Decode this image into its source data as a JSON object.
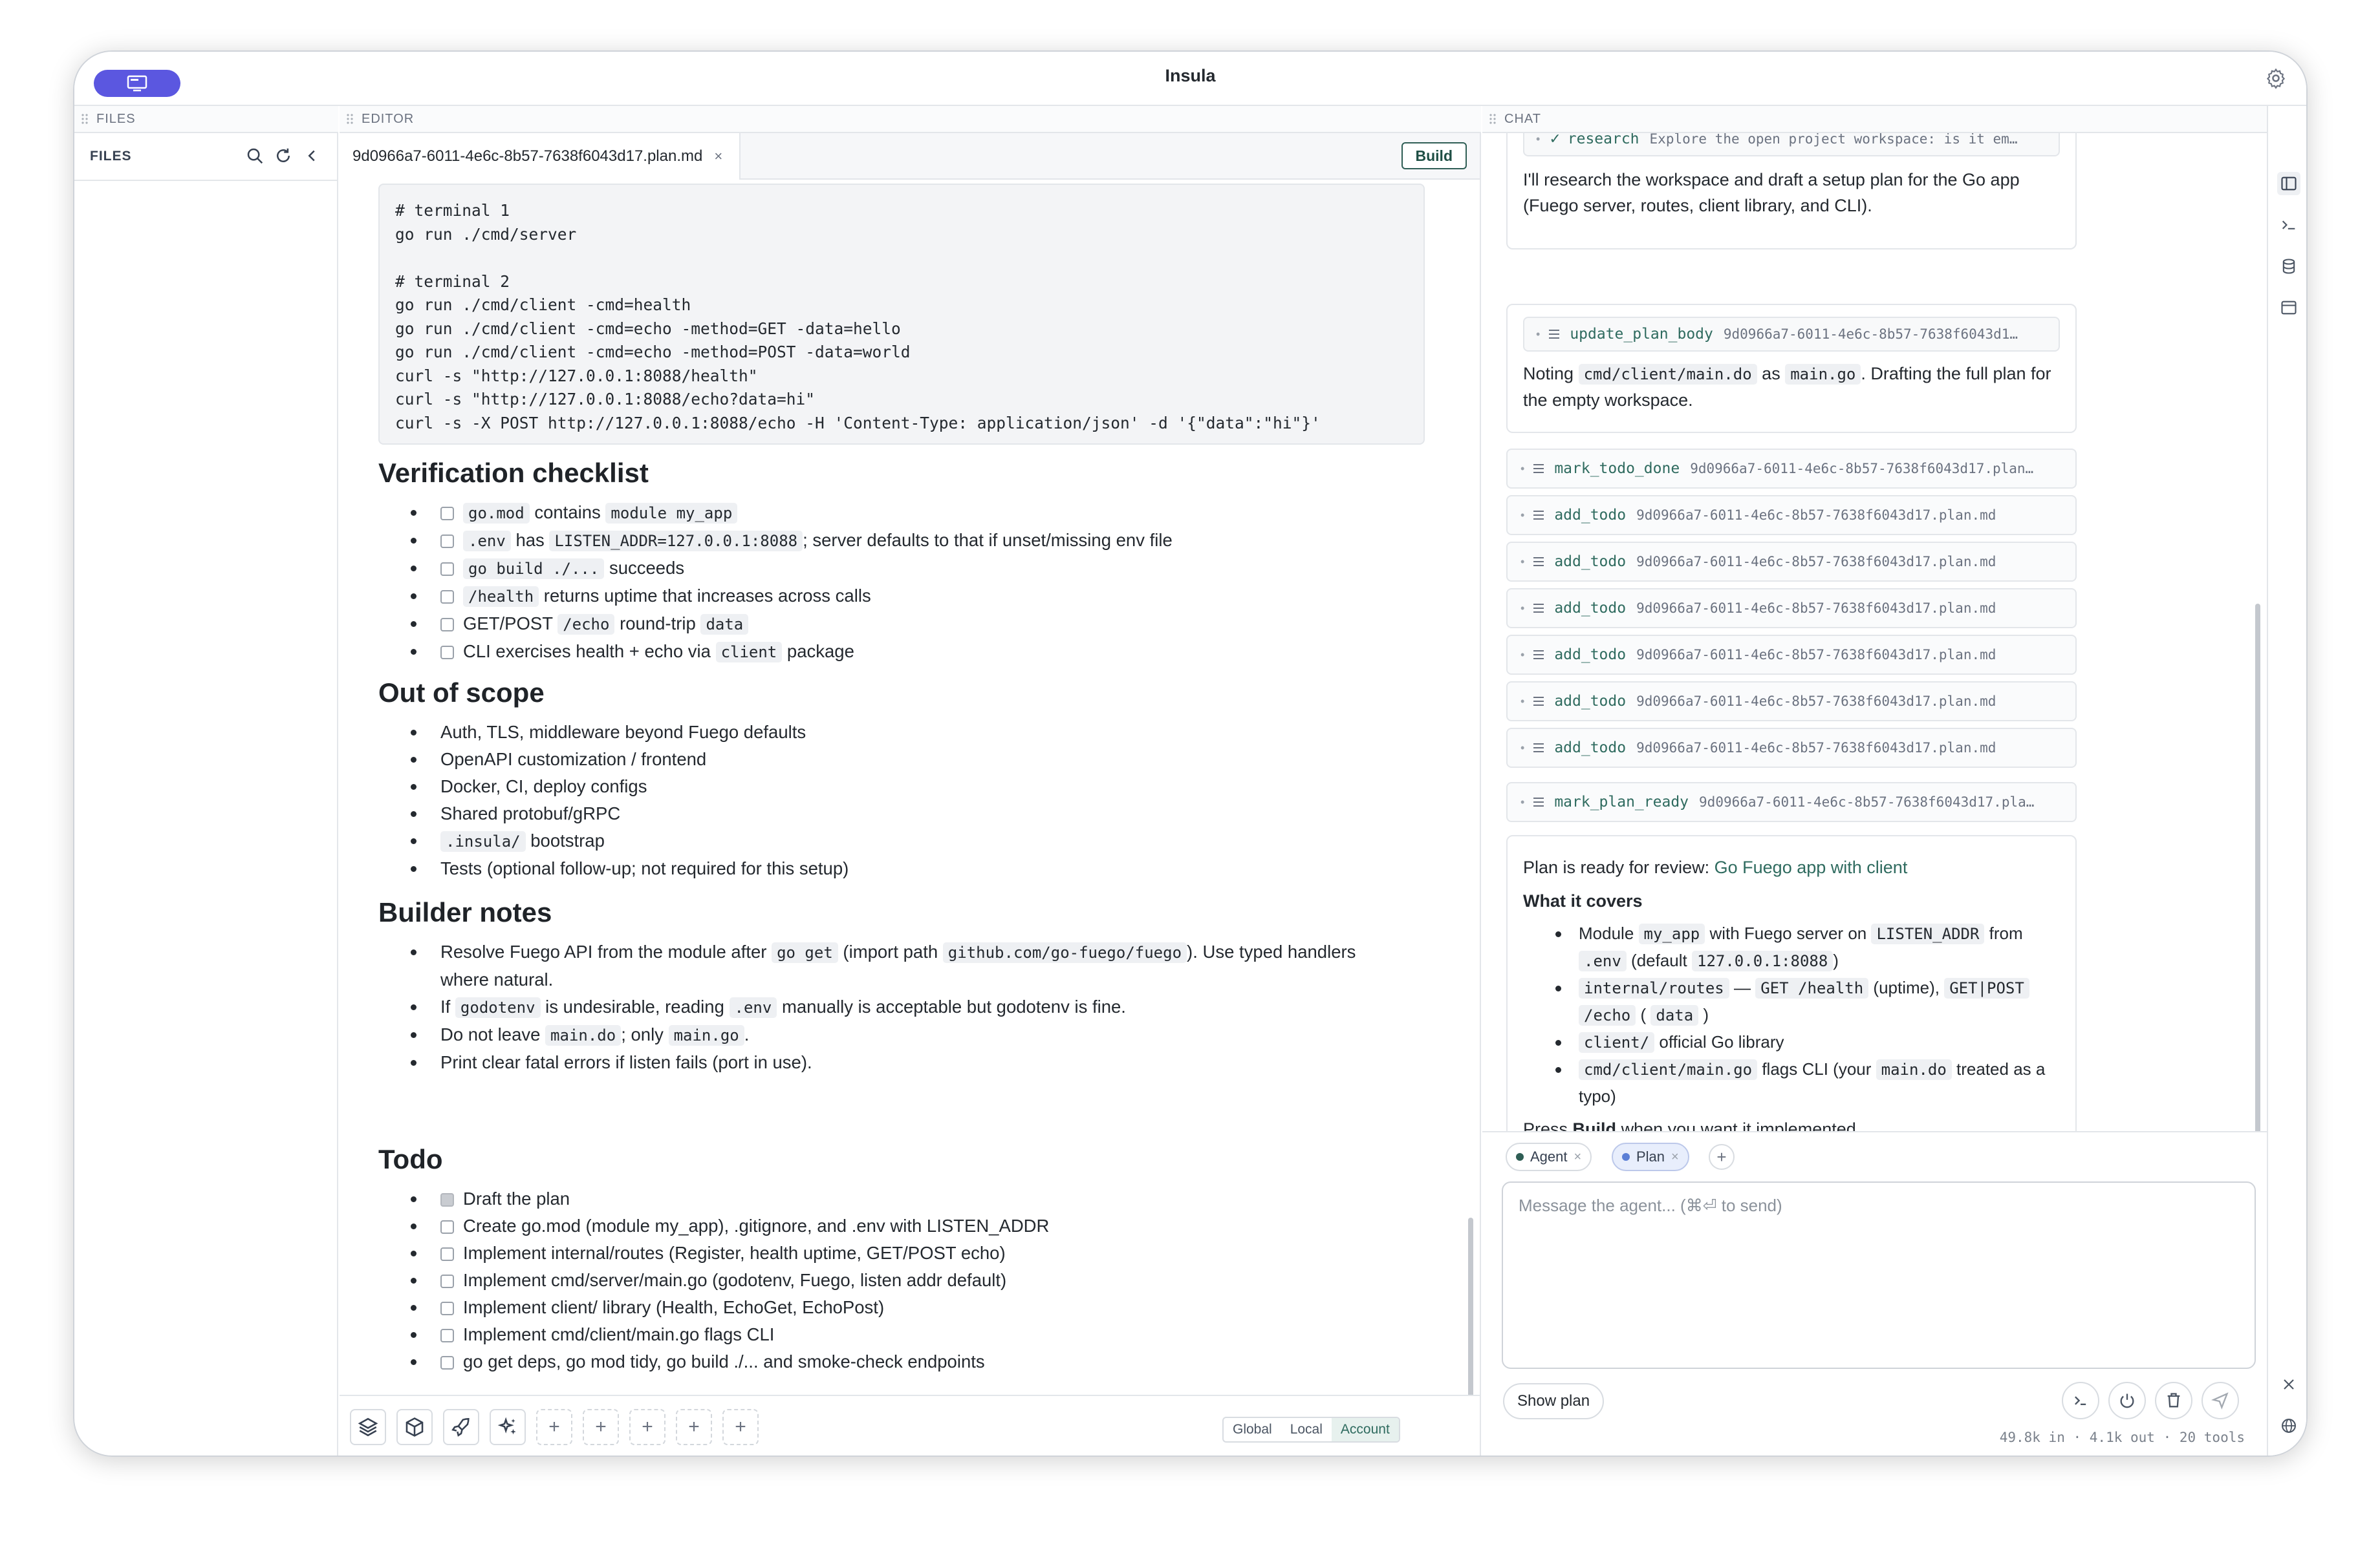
{
  "app": {
    "title": "Insula"
  },
  "panels": {
    "files": "FILES",
    "editor": "EDITOR",
    "chat": "CHAT"
  },
  "files": {
    "title": "FILES"
  },
  "editor": {
    "tab_name": "9d0966a7-6011-4e6c-8b57-7638f6043d17.plan.md",
    "tab_close": "×",
    "build_label": "Build",
    "code_lines": [
      "# terminal 1",
      "go run ./cmd/server",
      "",
      "# terminal 2",
      "go run ./cmd/client -cmd=health",
      "go run ./cmd/client -cmd=echo -method=GET -data=hello",
      "go run ./cmd/client -cmd=echo -method=POST -data=world",
      "curl -s \"http://127.0.0.1:8088/health\"",
      "curl -s \"http://127.0.0.1:8088/echo?data=hi\"",
      "curl -s -X POST http://127.0.0.1:8088/echo -H 'Content-Type: application/json' -d '{\"data\":\"hi\"}'"
    ],
    "verification": {
      "heading": "Verification checklist",
      "i1": {
        "c1": "go.mod",
        "t1": "contains",
        "c2": "module my_app"
      },
      "i2": {
        "c1": ".env",
        "t1": "has",
        "c2": "LISTEN_ADDR=127.0.0.1:8088",
        "t2": "; server defaults to that if unset/missing env file"
      },
      "i3": {
        "c1": "go build ./...",
        "t1": "succeeds"
      },
      "i4": {
        "c1": "/health",
        "t1": "returns uptime that increases across calls"
      },
      "i5": {
        "t0": "GET/POST",
        "c1": "/echo",
        "t1": "round-trip",
        "c2": "data"
      },
      "i6": {
        "t0": "CLI exercises health + echo via",
        "c1": "client",
        "t1": "package"
      }
    },
    "scope": {
      "heading": "Out of scope",
      "i1": "Auth, TLS, middleware beyond Fuego defaults",
      "i2": "OpenAPI customization / frontend",
      "i3": "Docker, CI, deploy configs",
      "i4": "Shared protobuf/gRPC",
      "i5": {
        "c1": ".insula/",
        "t1": "bootstrap"
      },
      "i6": "Tests (optional follow-up; not required for this setup)"
    },
    "builder": {
      "heading": "Builder notes",
      "i1": {
        "t0": "Resolve Fuego API from the module after",
        "c1": "go get",
        "t1": "(import path",
        "c2": "github.com/go-fuego/fuego",
        "t2": "). Use typed handlers",
        "t3": "where natural."
      },
      "i2": {
        "t0": "If",
        "c1": "godotenv",
        "t1": "is undesirable, reading",
        "c2": ".env",
        "t2": "manually is acceptable but godotenv is fine."
      },
      "i3": {
        "t0": "Do not leave",
        "c1": "main.do",
        "t1": "; only",
        "c2": "main.go",
        "t2": "."
      },
      "i4": "Print clear fatal errors if listen fails (port in use)."
    },
    "todo": {
      "heading": "Todo",
      "items": [
        {
          "label": "Draft the plan",
          "done": true
        },
        {
          "label": "Create go.mod (module my_app), .gitignore, and .env with LISTEN_ADDR",
          "done": false
        },
        {
          "label": "Implement internal/routes (Register, health uptime, GET/POST echo)",
          "done": false
        },
        {
          "label": "Implement cmd/server/main.go (godotenv, Fuego, listen addr default)",
          "done": false
        },
        {
          "label": "Implement client/ library (Health, EchoGet, EchoPost)",
          "done": false
        },
        {
          "label": "Implement cmd/client/main.go flags CLI",
          "done": false
        },
        {
          "label": "go get deps, go mod tidy, go build ./... and smoke-check endpoints",
          "done": false
        }
      ]
    },
    "toolbar_plus": "+",
    "scopes": {
      "global": "Global",
      "local": "Local",
      "account": "Account"
    }
  },
  "chat": {
    "research_name": "research",
    "research_arg": "Explore the open project workspace: is it em…",
    "msg1": "I'll research the workspace and draft a setup plan for the Go app (Fuego server, routes, client library, and CLI).",
    "update_name": "update_plan_body",
    "update_arg": "9d0966a7-6011-4e6c-8b57-7638f6043d1…",
    "msg2": {
      "t0": "Noting",
      "c1": "cmd/client/main.do",
      "t1": "as",
      "c2": "main.go",
      "t2": ". Drafting the full plan for the empty workspace."
    },
    "tools": [
      {
        "name": "mark_todo_done",
        "arg": "9d0966a7-6011-4e6c-8b57-7638f6043d17.plan…"
      },
      {
        "name": "add_todo",
        "arg": "9d0966a7-6011-4e6c-8b57-7638f6043d17.plan.md"
      },
      {
        "name": "add_todo",
        "arg": "9d0966a7-6011-4e6c-8b57-7638f6043d17.plan.md"
      },
      {
        "name": "add_todo",
        "arg": "9d0966a7-6011-4e6c-8b57-7638f6043d17.plan.md"
      },
      {
        "name": "add_todo",
        "arg": "9d0966a7-6011-4e6c-8b57-7638f6043d17.plan.md"
      },
      {
        "name": "add_todo",
        "arg": "9d0966a7-6011-4e6c-8b57-7638f6043d17.plan.md"
      },
      {
        "name": "add_todo",
        "arg": "9d0966a7-6011-4e6c-8b57-7638f6043d17.plan.md"
      }
    ],
    "ready_name": "mark_plan_ready",
    "ready_arg": "9d0966a7-6011-4e6c-8b57-7638f6043d17.pla…",
    "final": {
      "t0": "Plan is ready for review:",
      "link": "Go Fuego app with client",
      "covers": "What it covers",
      "b1": {
        "t0": "Module",
        "c1": "my_app",
        "t1": "with Fuego server on",
        "c2": "LISTEN_ADDR",
        "t2": "from",
        "c3": ".env",
        "t3": "(default",
        "c4": "127.0.0.1:8088",
        "t4": ")"
      },
      "b2": {
        "c1": "internal/routes",
        "t1": "—",
        "c2": "GET /health",
        "t2": "(uptime),",
        "c3": "GET|POST",
        "c4": "/echo",
        "t3": "(",
        "c5": "data",
        "t4": ")"
      },
      "b3": {
        "c1": "client/",
        "t1": "official Go library"
      },
      "b4": {
        "c1": "cmd/client/main.go",
        "t1": "flags CLI (your",
        "c2": "main.do",
        "t2": "treated as a typo)"
      },
      "press": "Press",
      "press_b": "Build",
      "press_t": "when you want it implemented."
    },
    "chips": [
      {
        "label": "Agent",
        "close": "×"
      },
      {
        "label": "Plan",
        "close": "×"
      }
    ],
    "add_chip": "+",
    "placeholder": "Message the agent... (⌘⏎ to send)",
    "show_plan": "Show plan",
    "usage": "49.8k in · 4.1k out · 20 tools"
  },
  "colors": {
    "accent": "#5b57e0",
    "teal": "#2f6b5f",
    "plan_chip_bg": "#e8eefc"
  }
}
